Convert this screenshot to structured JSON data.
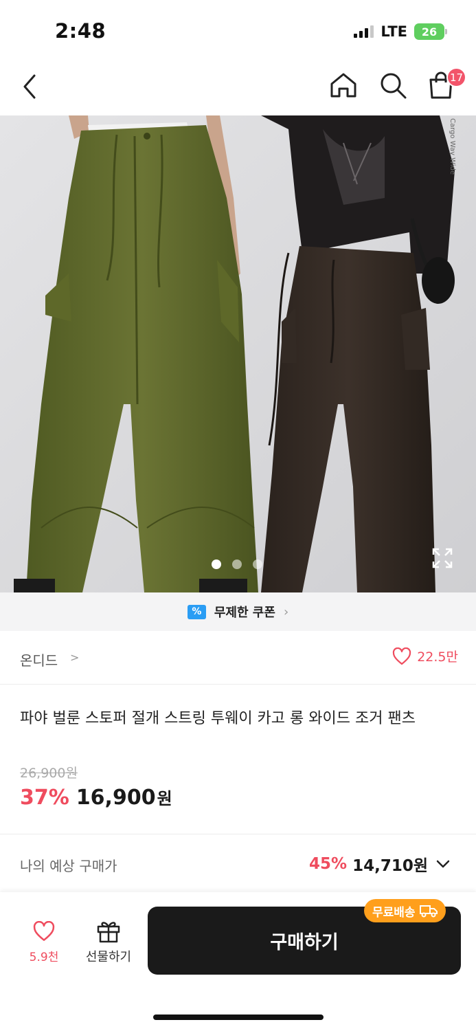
{
  "status_bar": {
    "time": "2:48",
    "network": "LTE",
    "battery": "26"
  },
  "nav": {
    "cart_count": "17",
    "icons": [
      "back-arrow-icon",
      "home-icon",
      "search-icon",
      "shopping-bag-icon"
    ]
  },
  "gallery": {
    "slide_count": 3,
    "active_index": 0
  },
  "coupon": {
    "icon_text": "%",
    "label": "무제한 쿠폰",
    "chevron": "›"
  },
  "brand": {
    "name": "온디드",
    "chevron": ">",
    "like_count": "22.5만"
  },
  "product": {
    "title": "파야 벌룬 스토퍼 절개 스트링 투웨이 카고 롱 와이드 조거 팬츠",
    "original_price": "26,900원",
    "discount": "37%",
    "sale_price": "16,900",
    "sale_unit": "원"
  },
  "expected": {
    "label": "나의 예상 구매가",
    "discount": "45%",
    "price": "14,710원"
  },
  "bottom_bar": {
    "like_count": "5.9천",
    "gift_label": "선물하기",
    "buy_label": "구매하기",
    "free_shipping": "무료배송"
  },
  "colors": {
    "accent": "#ef4c5e",
    "buy_button": "#1a1a1a",
    "free_ship_badge": "#ff9f1c",
    "coupon_icon": "#2a9df4"
  }
}
